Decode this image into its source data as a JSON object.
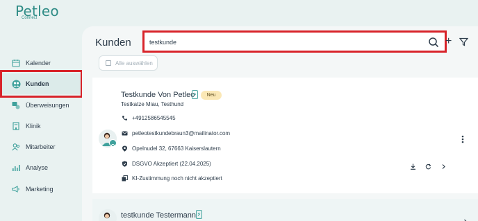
{
  "app": {
    "logo": "Petleo",
    "logo_sub": "Connect"
  },
  "sidebar": {
    "items": [
      {
        "label": "Kalender",
        "icon": "calendar-icon",
        "active": false
      },
      {
        "label": "Kunden",
        "icon": "customers-icon",
        "active": true
      },
      {
        "label": "Überweisungen",
        "icon": "referral-icon",
        "active": false
      },
      {
        "label": "Klinik",
        "icon": "building-icon",
        "active": false
      },
      {
        "label": "Mitarbeiter",
        "icon": "staff-icon",
        "active": false
      },
      {
        "label": "Analyse",
        "icon": "bar-chart-icon",
        "active": false
      },
      {
        "label": "Marketing",
        "icon": "megaphone-icon",
        "active": false
      }
    ]
  },
  "header": {
    "title": "Kunden"
  },
  "search": {
    "value": "testkunde"
  },
  "toolbar": {
    "select_all": "Alle auswählen"
  },
  "customers": [
    {
      "name": "Testkunde Von Petleo",
      "badge": "Neu",
      "pets": "Testkatze Miau, Testhund",
      "phone": "+4912586545545",
      "email": "petleotestkundebraun3@mailinator.com",
      "address": "Opelnudel 32, 67663 Kaiserslautern",
      "gdpr": "DSGVO Akzeptiert (22.04.2025)",
      "ai_consent": "KI-Zustimmung noch nicht akzeptiert"
    },
    {
      "name": "testkunde Testermann"
    }
  ],
  "colors": {
    "accent": "#3fa19c",
    "highlight": "#d8232a",
    "badge": "#fbe8b6"
  }
}
